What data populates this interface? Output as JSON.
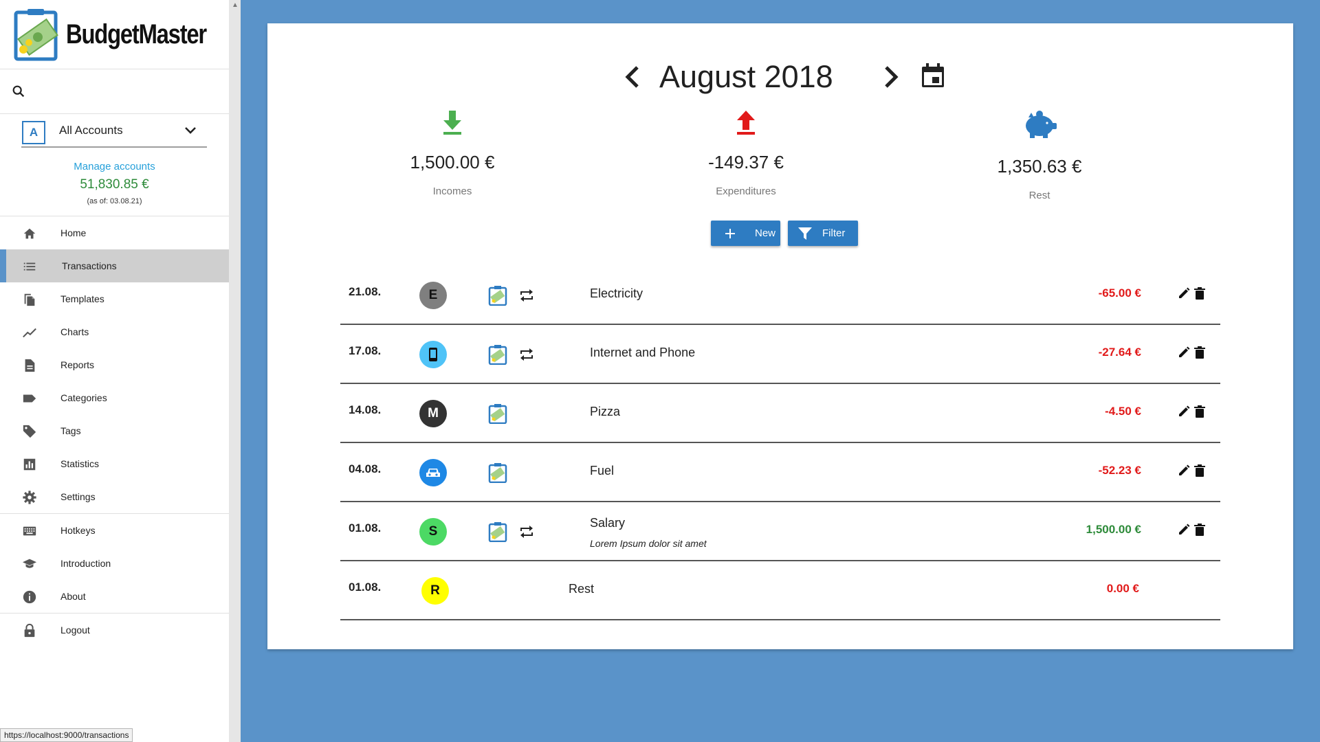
{
  "app": {
    "brand": "BudgetMaster"
  },
  "search": {
    "placeholder": ""
  },
  "account": {
    "avatar": "A",
    "selected": "All Accounts",
    "manage_label": "Manage accounts",
    "balance": "51,830.85 €",
    "as_of": "(as of: 03.08.21)"
  },
  "nav": [
    {
      "label": "Home",
      "icon": "home-icon"
    },
    {
      "label": "Transactions",
      "icon": "list-icon",
      "active": true
    },
    {
      "label": "Templates",
      "icon": "templates-icon"
    },
    {
      "label": "Charts",
      "icon": "chart-line-icon"
    },
    {
      "label": "Reports",
      "icon": "report-icon"
    },
    {
      "label": "Categories",
      "icon": "label-icon"
    },
    {
      "label": "Tags",
      "icon": "tag-icon"
    },
    {
      "label": "Statistics",
      "icon": "bar-chart-icon"
    },
    {
      "label": "Settings",
      "icon": "gear-icon"
    },
    {
      "label": "Hotkeys",
      "icon": "keyboard-icon"
    },
    {
      "label": "Introduction",
      "icon": "graduation-cap-icon"
    },
    {
      "label": "About",
      "icon": "info-icon"
    },
    {
      "label": "Logout",
      "icon": "lock-icon"
    }
  ],
  "status_url": "https://localhost:9000/transactions",
  "month": {
    "title": "August 2018"
  },
  "summary": {
    "incomes": {
      "amount": "1,500.00 €",
      "label": "Incomes"
    },
    "expenditures": {
      "amount": "-149.37 €",
      "label": "Expenditures"
    },
    "rest": {
      "amount": "1,350.63 €",
      "label": "Rest"
    }
  },
  "buttons": {
    "new": "New",
    "filter": "Filter"
  },
  "colors": {
    "accent": "#2e7cc2",
    "background": "#5a93c9",
    "negative": "#e11a1a",
    "positive": "#2e8b3a"
  },
  "transactions": [
    {
      "date": "21.08.",
      "category_letter": "E",
      "category_color": "#7f7f7f",
      "category_icon": "",
      "repeating": true,
      "name": "Electricity",
      "description": "",
      "amount": "-65.00 €",
      "sign": "neg"
    },
    {
      "date": "17.08.",
      "category_letter": "",
      "category_color": "#4fc3f7",
      "category_icon": "phone-icon",
      "repeating": true,
      "name": "Internet and Phone",
      "description": "",
      "amount": "-27.64 €",
      "sign": "neg"
    },
    {
      "date": "14.08.",
      "category_letter": "M",
      "category_color": "#333333",
      "category_icon": "",
      "repeating": false,
      "name": "Pizza",
      "description": "",
      "amount": "-4.50 €",
      "sign": "neg"
    },
    {
      "date": "04.08.",
      "category_letter": "",
      "category_color": "#1e88e5",
      "category_icon": "car-icon",
      "repeating": false,
      "name": "Fuel",
      "description": "",
      "amount": "-52.23 €",
      "sign": "neg"
    },
    {
      "date": "01.08.",
      "category_letter": "S",
      "category_color": "#4cd964",
      "category_icon": "",
      "repeating": true,
      "name": "Salary",
      "description": "Lorem Ipsum dolor sit amet",
      "amount": "1,500.00 €",
      "sign": "pos"
    },
    {
      "date": "01.08.",
      "category_letter": "R",
      "category_color": "#ffff00",
      "category_icon": "",
      "repeating": false,
      "name": "Rest",
      "description": "",
      "amount": "0.00 €",
      "sign": "neg",
      "is_rest": true
    }
  ]
}
